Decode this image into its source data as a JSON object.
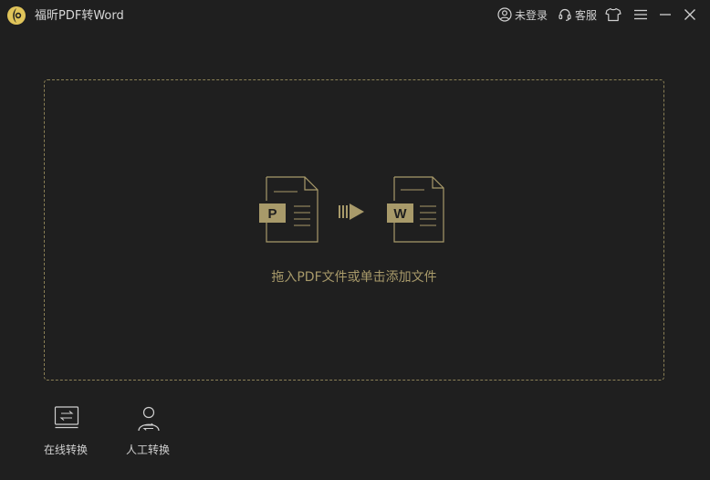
{
  "app": {
    "title": "福昕PDF转Word",
    "logo_icon": "foxit-logo-icon",
    "accent_color": "#c9b46a"
  },
  "titlebar": {
    "login_label": "未登录",
    "login_icon": "user-circle-icon",
    "service_label": "客服",
    "service_icon": "headset-icon",
    "skin_icon": "tshirt-icon",
    "menu_icon": "hamburger-menu-icon",
    "minimize_icon": "minimize-icon",
    "close_icon": "close-icon"
  },
  "dropzone": {
    "hint": "拖入PDF文件或单击添加文件",
    "source_letter": "P",
    "target_letter": "W",
    "border_color": "#8a7f55"
  },
  "tools": [
    {
      "label": "在线转换",
      "icon": "online-convert-icon"
    },
    {
      "label": "人工转换",
      "icon": "manual-convert-icon"
    }
  ]
}
